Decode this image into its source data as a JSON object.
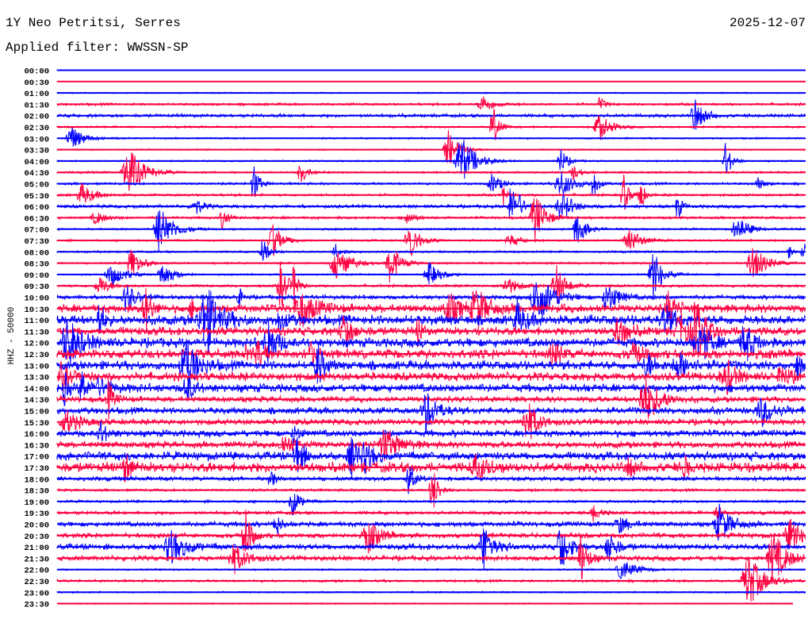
{
  "header": {
    "station": "1Y Neo Petritsi, Serres",
    "filter": "Applied filter: WWSSN-SP",
    "date": "2025-12-07"
  },
  "chart_data": {
    "type": "line",
    "title": "1Y Neo Petritsi, Serres",
    "ylabel": "HHZ - 50000",
    "colors": [
      "#0000ff",
      "#ff0040"
    ],
    "rows": [
      "00:00",
      "00:30",
      "01:00",
      "01:30",
      "02:00",
      "02:30",
      "03:00",
      "03:30",
      "04:00",
      "04:30",
      "05:00",
      "05:30",
      "06:00",
      "06:30",
      "07:00",
      "07:30",
      "08:00",
      "08:30",
      "09:00",
      "09:30",
      "10:00",
      "10:30",
      "11:00",
      "11:30",
      "12:00",
      "12:30",
      "13:00",
      "13:30",
      "14:00",
      "14:30",
      "15:00",
      "15:30",
      "16:00",
      "16:30",
      "17:00",
      "17:30",
      "18:00",
      "18:30",
      "19:00",
      "19:30",
      "20:00",
      "20:30",
      "21:00",
      "21:30",
      "22:00",
      "22:30",
      "23:00",
      "23:30"
    ],
    "relative_noise_level": [
      0.05,
      0.02,
      0.08,
      0.15,
      0.2,
      0.12,
      0.1,
      0.08,
      0.1,
      0.12,
      0.15,
      0.15,
      0.2,
      0.15,
      0.12,
      0.12,
      0.12,
      0.12,
      0.1,
      0.15,
      0.25,
      0.5,
      0.6,
      0.5,
      0.55,
      0.55,
      0.55,
      0.5,
      0.5,
      0.35,
      0.4,
      0.35,
      0.4,
      0.4,
      0.5,
      0.6,
      0.25,
      0.15,
      0.15,
      0.2,
      0.3,
      0.3,
      0.35,
      0.3,
      0.1,
      0.15,
      0.1,
      0.08
    ],
    "event_count": [
      0,
      0,
      0,
      2,
      1,
      2,
      1,
      1,
      3,
      3,
      5,
      4,
      6,
      4,
      3,
      4,
      4,
      4,
      4,
      5,
      4,
      6,
      6,
      5,
      5,
      5,
      5,
      4,
      4,
      2,
      2,
      2,
      2,
      2,
      3,
      4,
      2,
      1,
      1,
      2,
      3,
      3,
      4,
      3,
      1,
      1,
      0,
      0
    ]
  }
}
